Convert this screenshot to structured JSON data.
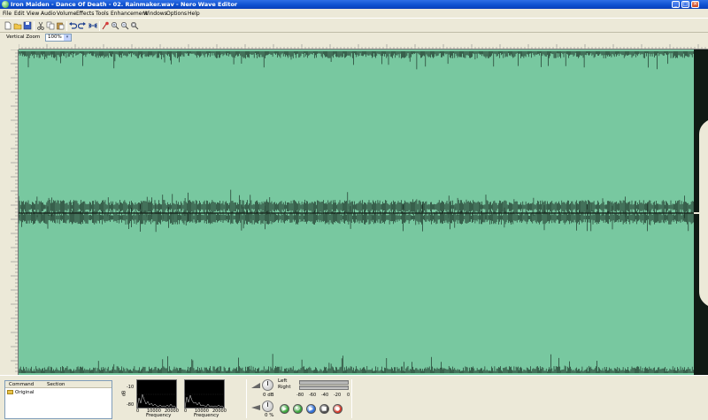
{
  "window": {
    "title": "Iron Maiden - Dance Of Death - 02. Rainmaker.wav - Nero Wave Editor",
    "controls": {
      "minimize": "_",
      "maximize": "□",
      "close": "×"
    }
  },
  "menu": [
    "File",
    "Edit",
    "View",
    "Audio",
    "Volume",
    "Effects",
    "Tools",
    "Enhancement",
    "Windows",
    "Options",
    "Help"
  ],
  "toolbar": {
    "buttons": [
      "new-file",
      "open-folder",
      "save",
      "cut",
      "copy",
      "paste",
      "undo",
      "redo",
      "fit-horizontal",
      "marker",
      "zoom-in",
      "zoom-out",
      "zoom-fit"
    ]
  },
  "zoom": {
    "label": "Vertical Zoom",
    "value": "100%",
    "arrow": "▾"
  },
  "command_panel": {
    "columns": [
      "Command",
      "Section"
    ],
    "rows": [
      {
        "command": "Original"
      }
    ]
  },
  "spectrum": {
    "y_labels": [
      "-10",
      "-80",
      "dB"
    ],
    "x_ticks": [
      "0",
      "10000",
      "20000"
    ],
    "x_label": "Frequency"
  },
  "levels": {
    "left_label": "Left",
    "right_label": "Right",
    "db_value": "0 dB",
    "percent_value": "0 %",
    "meter_ticks": [
      "-80",
      "-60",
      "-40",
      "-20",
      "0"
    ]
  },
  "transport": {
    "buttons": [
      {
        "name": "play-button",
        "glyph": "▶",
        "color": "#3aa53a"
      },
      {
        "name": "play-loop-button",
        "glyph": "↻",
        "color": "#3aa53a"
      },
      {
        "name": "play-selection-button",
        "glyph": "▶",
        "color": "#2f6fd6"
      },
      {
        "name": "stop-button",
        "glyph": "■",
        "color": "#4d4d4d"
      },
      {
        "name": "record-button",
        "glyph": "●",
        "color": "#d63b2a"
      }
    ]
  },
  "colors": {
    "waveform_background": "#78c8a0",
    "waveform_trace": "#0f1a14",
    "titlebar": "#0c4fcf"
  }
}
